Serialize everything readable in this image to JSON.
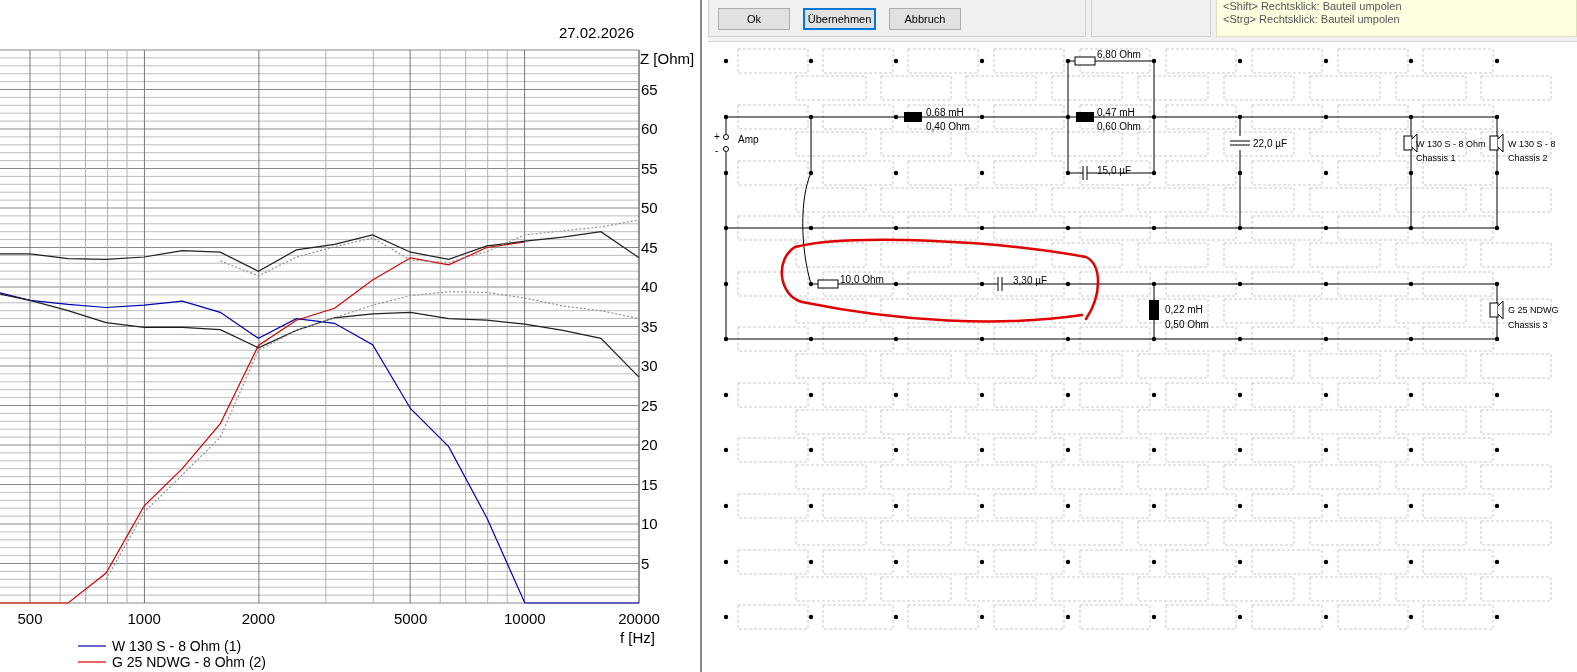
{
  "chart": {
    "date": "27.02.2026",
    "chart_data": {
      "type": "line",
      "xlabel": "f [Hz]",
      "ylabel": "Z [Ohm]",
      "grid": true,
      "legend": true,
      "ylim": [
        0,
        70
      ],
      "yticks": [
        5,
        10,
        15,
        20,
        25,
        30,
        35,
        40,
        45,
        50,
        55,
        60,
        65
      ],
      "categories": [
        null,
        "500",
        null,
        null,
        "1000",
        null,
        null,
        "2000",
        null,
        null,
        null,
        "5000",
        null,
        null,
        "10000",
        null,
        null,
        "20000"
      ],
      "series": [
        {
          "name": "W 130 S - 8 Ohm (1)",
          "color": "#0000b4",
          "line_style": "solid",
          "values": [
            39.5,
            38.3,
            37.8,
            37.4,
            37.7,
            38.2,
            36.8,
            33.5,
            36,
            35.4,
            32.7,
            24.6,
            19.8,
            10.8,
            0,
            0,
            0,
            0
          ]
        },
        {
          "name": "G 25 NDWG - 8 Ohm (2)",
          "color": "#d40000",
          "line_style": "solid",
          "values": [
            0,
            0,
            0,
            3.8,
            12.3,
            17,
            22.7,
            32.6,
            35.8,
            37.3,
            40.9,
            43.7,
            42.8,
            45,
            45.7,
            null,
            null,
            null
          ]
        },
        {
          "color": "#202020",
          "line_style": "solid",
          "values": [
            44.2,
            44.2,
            43.6,
            43.5,
            43.8,
            44.6,
            44.4,
            42,
            44.7,
            45.4,
            46.6,
            44.4,
            43.5,
            45.2,
            45.8,
            46.3,
            47,
            43.7
          ]
        },
        {
          "color": "#202020",
          "line_style": "solid",
          "values": [
            39.3,
            38.3,
            37,
            35.5,
            34.9,
            34.9,
            34.6,
            32.3,
            34.5,
            36.1,
            36.6,
            36.8,
            36,
            35.8,
            35.3,
            34.5,
            33.5,
            28.6
          ]
        },
        {
          "color": "#909090",
          "line_style": "dotted",
          "values": [
            null,
            null,
            null,
            null,
            null,
            null,
            43.3,
            41.4,
            43.8,
            45.1,
            46.2,
            43.4,
            43.1,
            44.5,
            46.6,
            47.1,
            47.6,
            48.5
          ]
        },
        {
          "color": "#909090",
          "line_style": "dotted",
          "values": [
            null,
            null,
            null,
            3,
            11.5,
            16.2,
            21,
            32,
            34.5,
            36.1,
            37.7,
            38.9,
            39.4,
            39.3,
            38.6,
            37.6,
            37,
            36
          ]
        }
      ]
    }
  },
  "toolbar": {
    "buttons": [
      {
        "label": "Ok",
        "focused": false
      },
      {
        "label": "Übernehmen",
        "focused": true
      },
      {
        "label": "Abbruch",
        "focused": false
      }
    ],
    "hint_lines": [
      "<Shift> Rechtsklick: Bauteil umpolen",
      "<Strg> Rechtsklick: Bauteil umpolen"
    ]
  },
  "circuit": {
    "amp": {
      "label": "Amp",
      "plus": "+",
      "minus": "-"
    },
    "components": [
      {
        "kind": "resistor",
        "labels": [
          "6,80 Ohm"
        ]
      },
      {
        "kind": "inductor",
        "labels": [
          "0,68 mH",
          "0,40 Ohm"
        ]
      },
      {
        "kind": "inductor",
        "labels": [
          "0,47 mH",
          "0,60 Ohm"
        ]
      },
      {
        "kind": "capacitor",
        "labels": [
          "22,0 µF"
        ]
      },
      {
        "kind": "speaker",
        "labels": [
          "W 130 S - 8 Ohm",
          "Chassis 1"
        ]
      },
      {
        "kind": "speaker",
        "labels": [
          "W 130 S - 8",
          "Chassis 2"
        ]
      },
      {
        "kind": "capacitor",
        "labels": [
          "15,0 µF"
        ]
      },
      {
        "kind": "resistor",
        "labels": [
          "10,0 Ohm"
        ]
      },
      {
        "kind": "capacitor",
        "labels": [
          "3,30 µF"
        ]
      },
      {
        "kind": "inductor",
        "labels": [
          "0,22 mH",
          "0,50 Ohm"
        ]
      },
      {
        "kind": "speaker",
        "labels": [
          "G 25 NDWG",
          "Chassis 3"
        ]
      }
    ]
  }
}
